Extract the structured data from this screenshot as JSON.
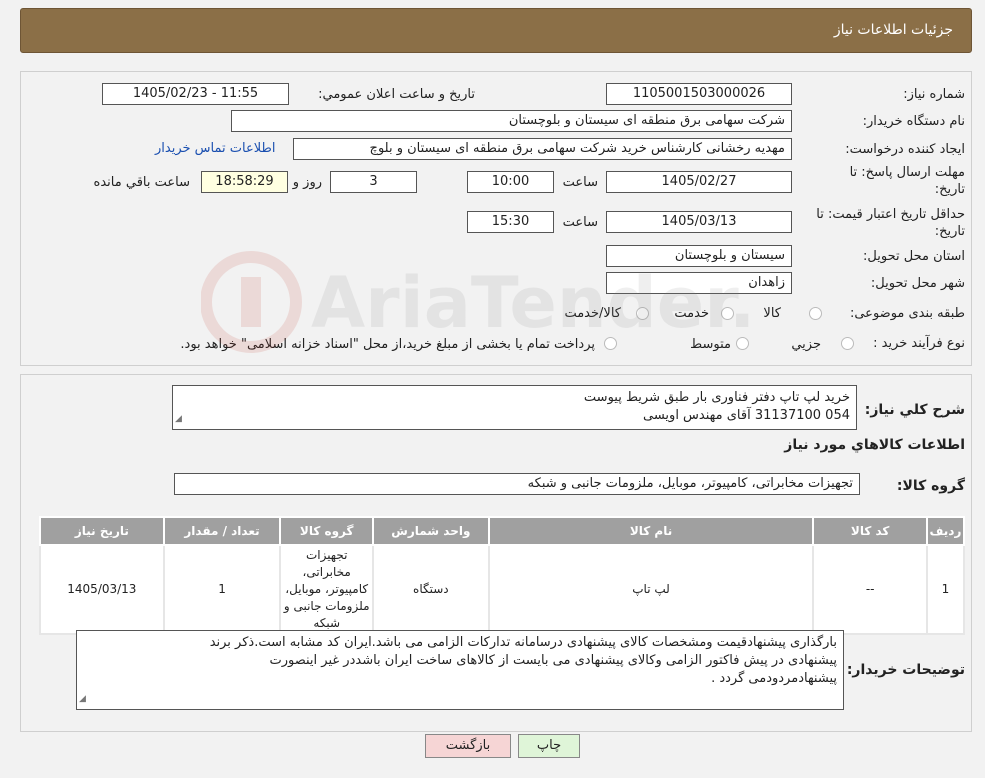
{
  "header": {
    "title": "جزئیات اطلاعات نیاز"
  },
  "form": {
    "need_number_label": "شماره نیاز:",
    "need_number": "1105001503000026",
    "announce_label": "تاریخ و ساعت اعلان عمومي:",
    "announce_value": "1405/02/23 - 11:55",
    "buyer_org_label": "نام دستگاه خريدار:",
    "buyer_org": "شرکت سهامی برق منطقه ای سیستان و بلوچستان",
    "creator_label": "ایجاد کننده درخواست:",
    "creator": "مهدیه رخشانی کارشناس خرید شرکت سهامی برق منطقه ای سیستان و بلوچ",
    "contact_link": "اطلاعات تماس خريدار",
    "deadline_label_1": "مهلت ارسال پاسخ: تا",
    "deadline_label_2": "تاریخ:",
    "deadline_date": "1405/02/27",
    "hour_label": "ساعت",
    "deadline_time": "10:00",
    "days_value": "3",
    "days_label": "روز و",
    "remaining_time": "18:58:29",
    "remaining_label": "ساعت باقي مانده",
    "price_validity_label_1": "حداقل تاریخ اعتبار قیمت: تا",
    "price_validity_label_2": "تاریخ:",
    "price_validity_date": "1405/03/13",
    "price_validity_time": "15:30",
    "province_label": "استان محل تحويل:",
    "province": "سیستان و بلوچستان",
    "city_label": "شهر محل تحويل:",
    "city": "زاهدان",
    "category_label": "طبقه بندی موضوعی:",
    "category_options": [
      "کالا",
      "خدمت",
      "کالا/خدمت"
    ],
    "process_label": "نوع فرآیند خرید :",
    "process_options": [
      "جزيي",
      "متوسط"
    ],
    "process_note": "پرداخت تمام یا بخشی از مبلغ خرید،از محل \"اسناد خزانه اسلامی\" خواهد بود."
  },
  "details": {
    "summary_label": "شرح کلي نياز:",
    "summary_lines": [
      "خرید لپ تاپ دفتر فناوری بار طبق شریط پیوست",
      "054 31137100 آقای مهندس اویسی"
    ],
    "goods_info_title": "اطلاعات کالاهاي مورد نياز",
    "goods_group_label": "گروه کالا:",
    "goods_group": "تجهیزات مخابراتی، کامپیوتر، موبایل، ملزومات جانبی و شبکه"
  },
  "table": {
    "headers": [
      "رديف",
      "کد کالا",
      "نام کالا",
      "واحد شمارش",
      "گروه کالا",
      "تعداد / مقدار",
      "تاریخ نیاز"
    ],
    "rows": [
      {
        "row": "1",
        "code": "--",
        "name": "لپ تاپ",
        "unit": "دستگاه",
        "group": "تجهیزات مخابراتی، کامپیوتر، موبایل، ملزومات جانبی و شبکه",
        "qty": "1",
        "date": "1405/03/13"
      }
    ]
  },
  "buyer_notes": {
    "label": "توضیحات خریدار:",
    "lines": [
      "بارگذاری پیشنهادقیمت ومشخصات کالای پیشنهادی درسامانه تدارکات الزامی می باشد.ایران کد مشابه است.ذکر برند",
      "پیشنهادی در پیش فاکتور الزامی وکالای پیشنهادی می بایست از کالاهای ساخت ایران باشددر غیر اینصورت",
      "پیشنهادمردودمی گردد ."
    ]
  },
  "buttons": {
    "print": "چاپ",
    "back": "بازگشت"
  },
  "watermark": {
    "text": "AriaTender.neT"
  },
  "colors": {
    "header": "#8b6f47",
    "link": "#1a4fb0",
    "back_button": "#f6d5d5",
    "print_button": "#dff5d8"
  }
}
